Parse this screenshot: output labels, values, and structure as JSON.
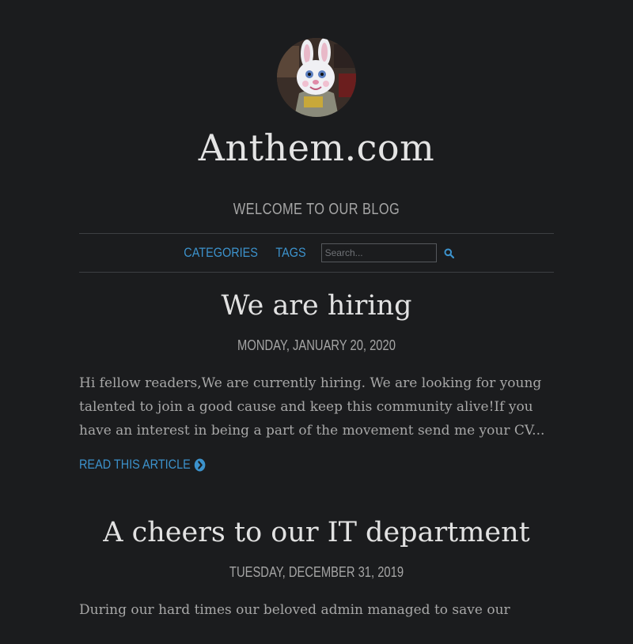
{
  "site": {
    "title": "Anthem.com",
    "tagline": "WELCOME TO OUR BLOG",
    "avatar_icon": "bunny-avatar"
  },
  "nav": {
    "categories_label": "CATEGORIES",
    "tags_label": "TAGS",
    "search_placeholder": "Search...",
    "search_icon": "search-icon",
    "link_color": "#3c92cc"
  },
  "posts": [
    {
      "title": "We are hiring",
      "date": "MONDAY, JANUARY 20, 2020",
      "excerpt": "Hi fellow readers,We are currently hiring. We are looking for young talented to join a good cause and keep this community alive!If you have an interest in being a part of the movement send me your CV...",
      "read_more_label": "READ THIS ARTICLE"
    },
    {
      "title": "A cheers to our IT department",
      "date": "TUESDAY, DECEMBER 31, 2019",
      "excerpt": "During our hard times our beloved admin managed to save our"
    }
  ],
  "colors": {
    "background": "#1b1c1e",
    "accent": "#3c92cc",
    "text": "#a7a7a7"
  }
}
